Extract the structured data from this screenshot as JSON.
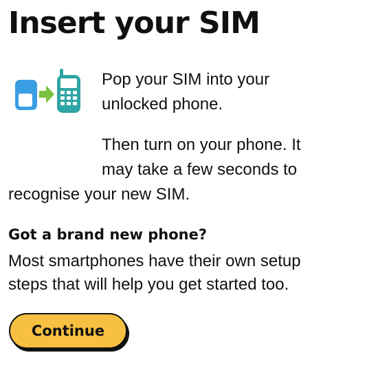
{
  "header": {
    "title": "Insert your SIM"
  },
  "illustration": {
    "icon": "sim-to-phone-icon",
    "colors": {
      "sim": "#3a9ee4",
      "arrow": "#7cc242",
      "phone": "#2fa4a6"
    }
  },
  "instructions": {
    "para1": [
      "Pop your SIM into your",
      "unlocked phone."
    ],
    "para2": [
      "Then turn on your phone. It",
      "may take a few seconds to",
      "recognise your new SIM."
    ]
  },
  "new_phone": {
    "heading": "Got a brand new phone?",
    "lines": [
      "Most smartphones have their own setup",
      "steps that will help you get started too."
    ]
  },
  "actions": {
    "continue_label": "Continue",
    "continue_color": "#f8c040"
  }
}
